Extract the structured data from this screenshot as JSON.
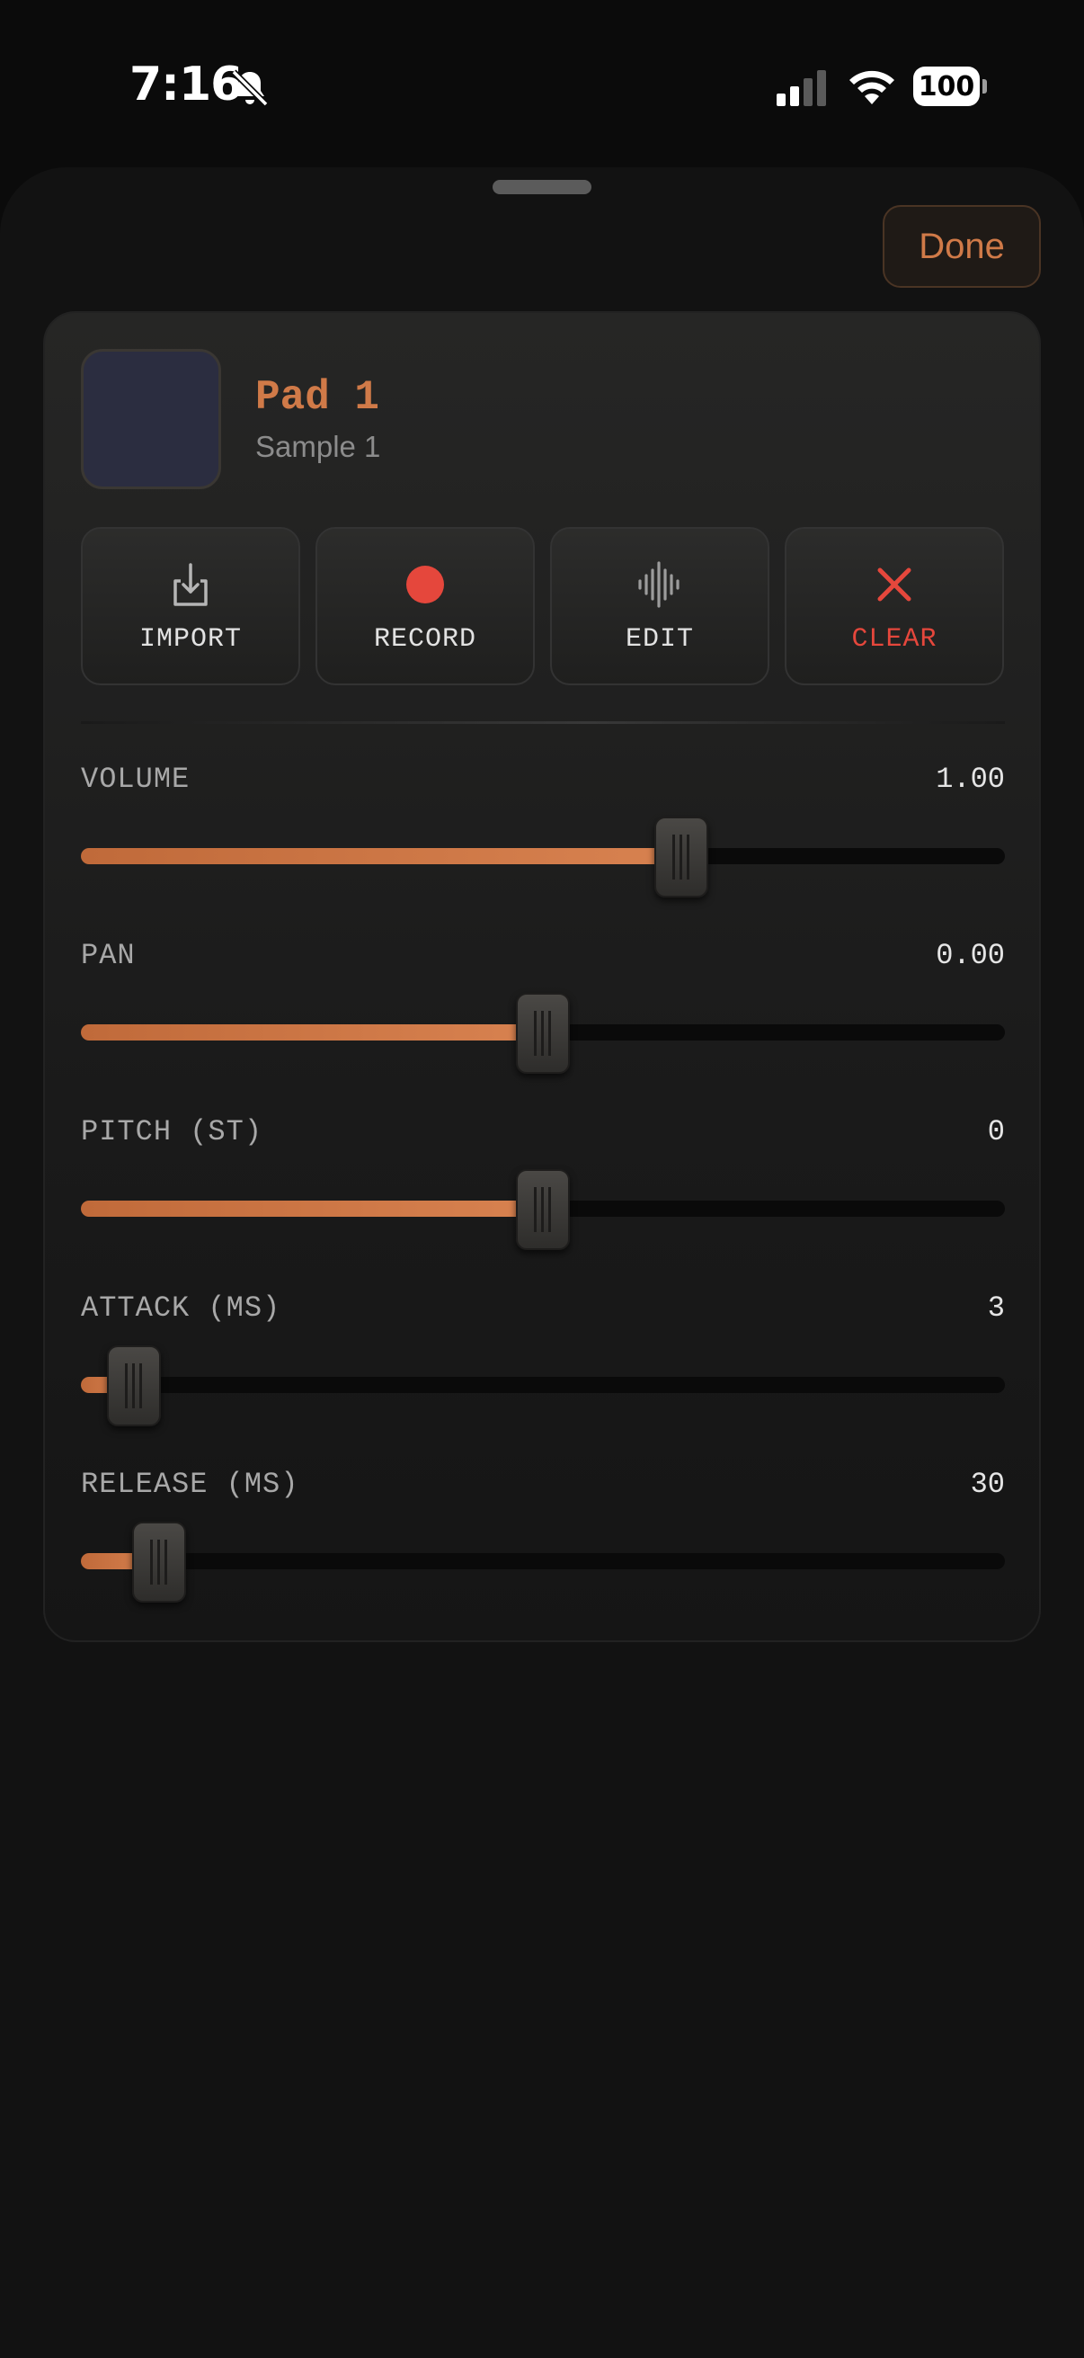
{
  "status": {
    "time": "7:16",
    "battery": "100"
  },
  "sheet": {
    "done_label": "Done"
  },
  "pad": {
    "title": "Pad 1",
    "sample": "Sample 1",
    "thumb_color": "#2b2d40"
  },
  "actions": [
    {
      "label": "IMPORT",
      "icon": "import-icon"
    },
    {
      "label": "RECORD",
      "icon": "record-dot-icon"
    },
    {
      "label": "EDIT",
      "icon": "waveform-icon"
    },
    {
      "label": "CLEAR",
      "icon": "close-x-icon"
    }
  ],
  "params": [
    {
      "name": "VOLUME",
      "value": "1.00",
      "fraction": 0.65
    },
    {
      "name": "PAN",
      "value": "0.00",
      "fraction": 0.5
    },
    {
      "name": "PITCH (ST)",
      "value": "0",
      "fraction": 0.5
    },
    {
      "name": "ATTACK (MS)",
      "value": "3",
      "fraction": 0.057
    },
    {
      "name": "RELEASE (MS)",
      "value": "30",
      "fraction": 0.085
    }
  ],
  "colors": {
    "accent": "#d07a48",
    "danger": "#e5473c"
  }
}
